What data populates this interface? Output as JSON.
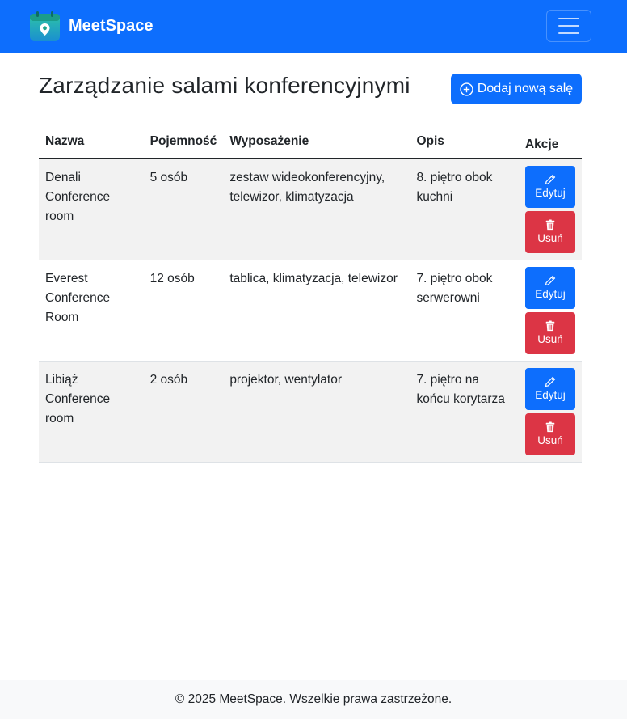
{
  "app": {
    "name": "MeetSpace",
    "logo_icon": "calendar-location-icon",
    "brand_color": "#0d6efd"
  },
  "navbar": {
    "toggler_icon": "hamburger-menu-icon"
  },
  "page": {
    "title": "Zarządzanie salami konferencyjnymi",
    "add_button_label": "Dodaj nową salę",
    "add_button_icon": "plus-circle-icon"
  },
  "table": {
    "headers": [
      "Nazwa",
      "Pojemność",
      "Wyposażenie",
      "Opis",
      "Akcje"
    ],
    "rows": [
      {
        "name": "Denali Conference room",
        "capacity": "5 osób",
        "equipment": "zestaw wideokonferencyjny, telewizor, klimatyzacja",
        "description": "8. piętro obok kuchni",
        "edit_label": "Edytuj",
        "delete_label": "Usuń"
      },
      {
        "name": "Everest Conference Room",
        "capacity": "12 osób",
        "equipment": "tablica, klimatyzacja, telewizor",
        "description": "7. piętro obok serwerowni",
        "edit_label": "Edytuj",
        "delete_label": "Usuń"
      },
      {
        "name": "Libiąż Conference room",
        "capacity": "2 osób",
        "equipment": "projektor, wentylator",
        "description": "7. piętro na końcu korytarza",
        "edit_label": "Edytuj",
        "delete_label": "Usuń"
      }
    ],
    "colors": {
      "edit": "#0d6efd",
      "delete": "#dc3545",
      "stripe": "#f2f2f2"
    }
  },
  "footer": {
    "text": "© 2025 MeetSpace. Wszelkie prawa zastrzeżone."
  }
}
